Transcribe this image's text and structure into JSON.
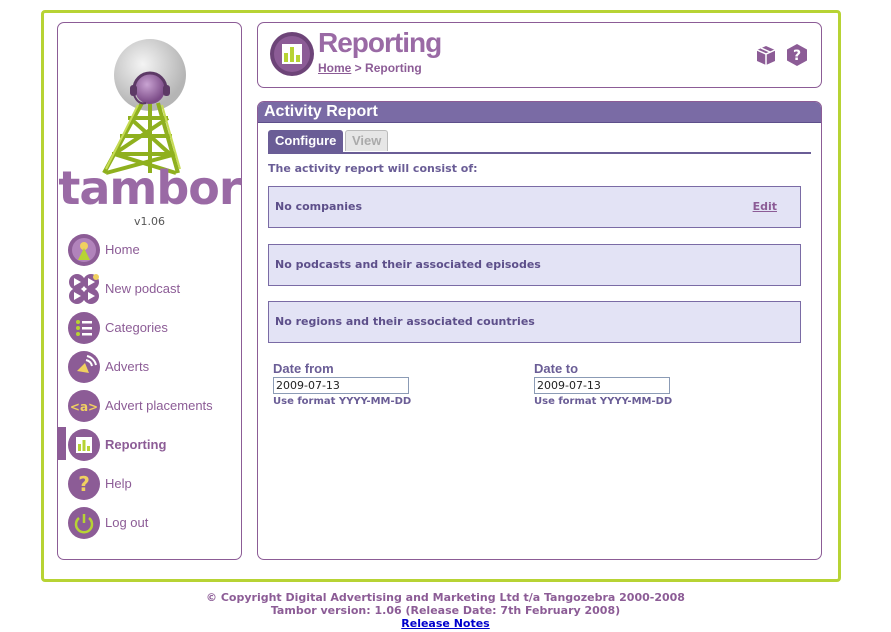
{
  "sidebar": {
    "brand": "tambor",
    "version": "v1.06",
    "items": [
      {
        "label": "Home",
        "icon": "home-icon"
      },
      {
        "label": "New podcast",
        "icon": "new-podcast-icon"
      },
      {
        "label": "Categories",
        "icon": "categories-icon"
      },
      {
        "label": "Adverts",
        "icon": "adverts-icon"
      },
      {
        "label": "Advert placements",
        "icon": "advert-placements-icon"
      },
      {
        "label": "Reporting",
        "icon": "reporting-icon",
        "active": true
      },
      {
        "label": "Help",
        "icon": "help-icon"
      },
      {
        "label": "Log out",
        "icon": "power-icon"
      }
    ]
  },
  "header": {
    "title": "Reporting",
    "breadcrumb_home": "Home",
    "breadcrumb_sep": " > ",
    "breadcrumb_current": "Reporting"
  },
  "panel": {
    "title": "Activity Report",
    "tabs": [
      {
        "label": "Configure",
        "active": true
      },
      {
        "label": "View",
        "active": false
      }
    ],
    "intro": "The activity report will consist of:",
    "boxes": [
      {
        "text": "No companies",
        "edit": "Edit"
      },
      {
        "text": "No podcasts and their associated episodes"
      },
      {
        "text": "No regions and their associated countries"
      }
    ],
    "date_from": {
      "label": "Date from",
      "value": "2009-07-13",
      "hint": "Use format YYYY-MM-DD"
    },
    "date_to": {
      "label": "Date to",
      "value": "2009-07-13",
      "hint": "Use format YYYY-MM-DD"
    }
  },
  "footer": {
    "copyright": "© Copyright Digital Advertising and Marketing Ltd t/a Tangozebra 2000-2008",
    "version_line": "Tambor version: 1.06 (Release Date: 7th February 2008)",
    "release_notes": "Release Notes"
  },
  "colors": {
    "frame": "#b7d334",
    "brand_purple": "#8c5c96",
    "panel_header": "#7a6ba5",
    "box_bg": "#e3e3f5"
  }
}
